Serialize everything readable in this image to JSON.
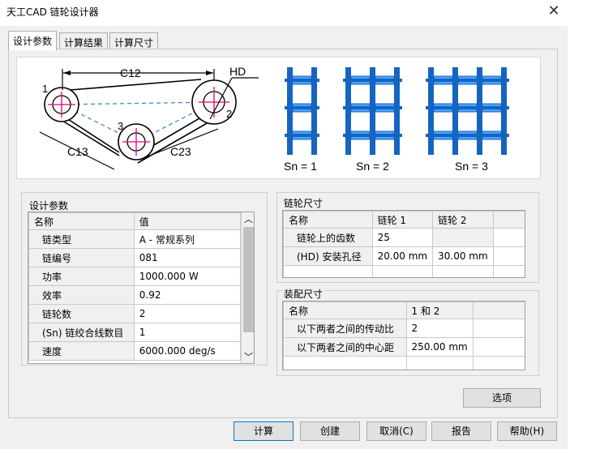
{
  "window": {
    "title": "天工CAD 链轮设计器",
    "close_glyph": "✕"
  },
  "tabs": [
    "设计参数",
    "计算结果",
    "计算尺寸"
  ],
  "diagram": {
    "labels": {
      "c12": "C12",
      "hd": "HD",
      "c13": "C13",
      "c23": "C23",
      "n1": "1",
      "n2": "2",
      "n3": "3",
      "sn1": "Sn = 1",
      "sn2": "Sn = 2",
      "sn3": "Sn = 3"
    },
    "colors": {
      "chain": "#1565c0",
      "chain_light": "#4aa3ff",
      "center_mark": "#e0007a",
      "dashed": "#4a86c8",
      "line": "#000000"
    }
  },
  "design_params": {
    "title": "设计参数",
    "headers": [
      "名称",
      "值"
    ],
    "rows": [
      {
        "name": "链类型",
        "value": "A - 常规系列"
      },
      {
        "name": "链编号",
        "value": "081"
      },
      {
        "name": "功率",
        "value": "1000.000 W"
      },
      {
        "name": "效率",
        "value": "0.92"
      },
      {
        "name": "链轮数",
        "value": "2"
      },
      {
        "name": "(Sn) 链绞合线数目",
        "value": "1"
      },
      {
        "name": "速度",
        "value": "6000.000 deg/s"
      }
    ],
    "scroll_up": "︿",
    "scroll_down": "﹀"
  },
  "sprocket_size": {
    "title": "链轮尺寸",
    "headers": [
      "名称",
      "链轮 1",
      "链轮 2"
    ],
    "rows": [
      {
        "name": "链轮上的齿数",
        "v1": "25",
        "v2": ""
      },
      {
        "name": "(HD) 安装孔径",
        "v1": "20.00 mm",
        "v2": "30.00 mm"
      }
    ]
  },
  "assembly_size": {
    "title": "装配尺寸",
    "headers": [
      "名称",
      "1 和 2"
    ],
    "rows": [
      {
        "name": "以下两者之间的传动比",
        "value": "2"
      },
      {
        "name": "以下两者之间的中心距",
        "value": "250.00 mm"
      }
    ]
  },
  "buttons": {
    "options": "选项",
    "calculate": "计算",
    "create": "创建",
    "cancel": "取消(C)",
    "report": "报告",
    "help": "帮助(H)"
  }
}
